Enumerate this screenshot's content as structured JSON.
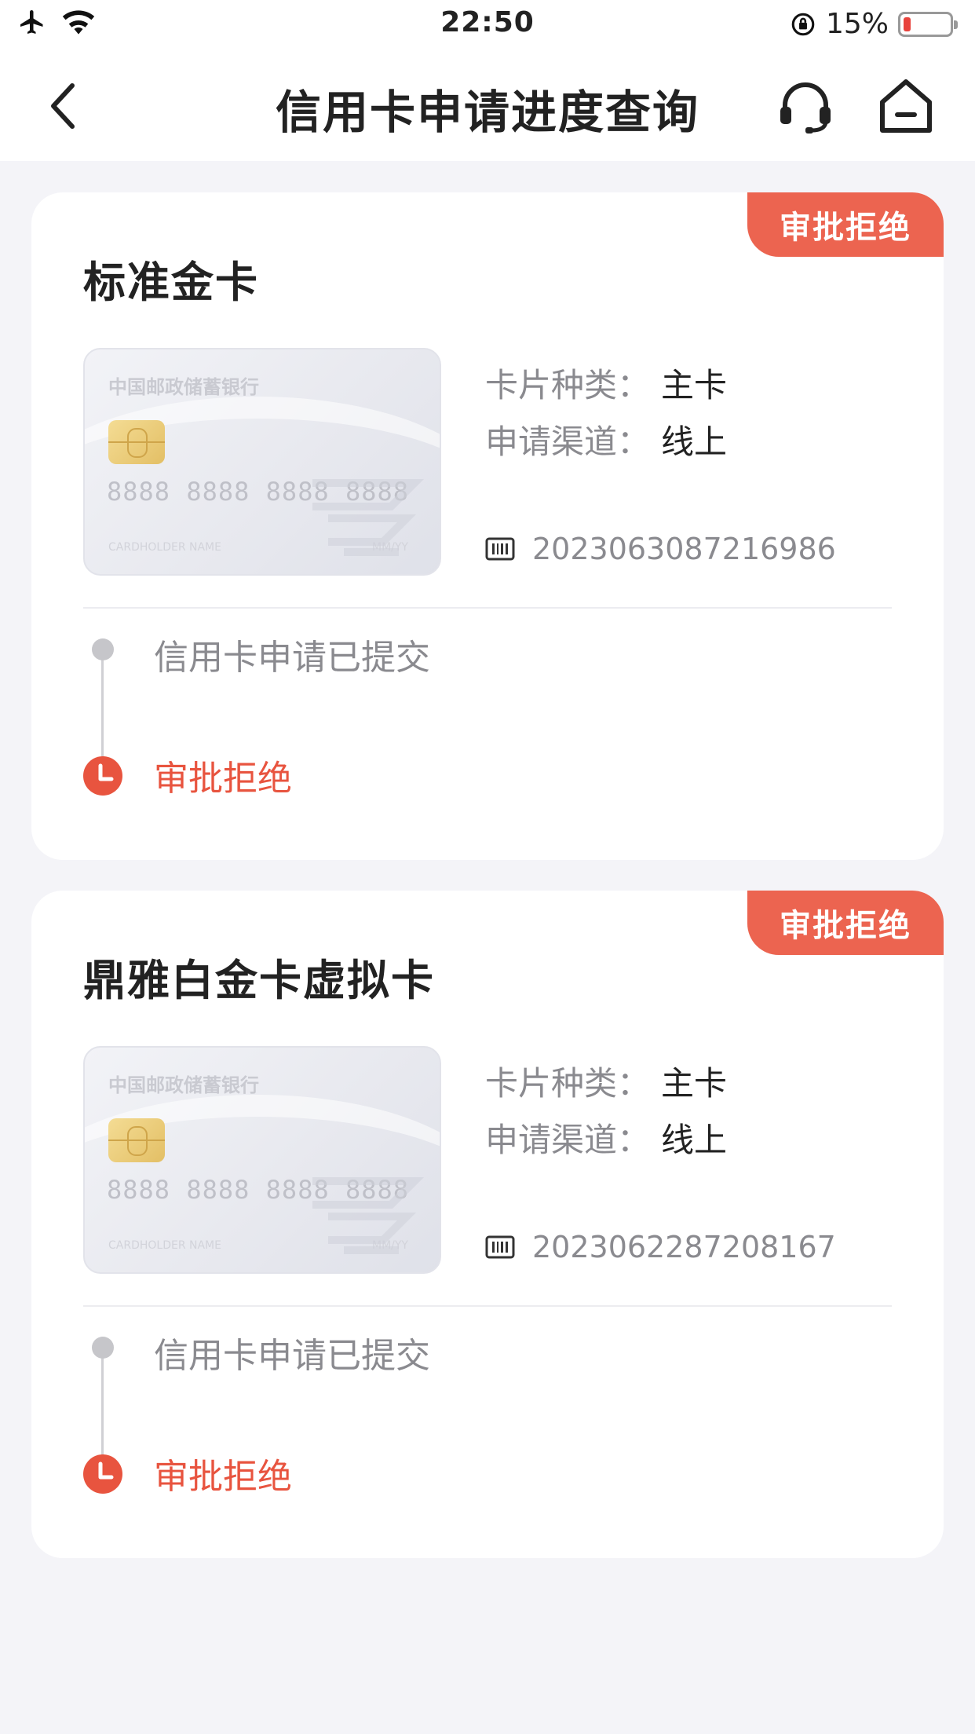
{
  "status_bar": {
    "time": "22:50",
    "battery_percent": "15%"
  },
  "header": {
    "title": "信用卡申请进度查询"
  },
  "applications": [
    {
      "status_badge": "审批拒绝",
      "card_name": "标准金卡",
      "card_visual": {
        "bank_name": "中国邮政储蓄银行",
        "number": "8888 8888 8888 8888",
        "holder_label": "CARDHOLDER NAME",
        "expiry_label": "MM/YY"
      },
      "card_type_label": "卡片种类：",
      "card_type_value": "主卡",
      "channel_label": "申请渠道：",
      "channel_value": "线上",
      "reference_number": "2023063087216986",
      "timeline": {
        "step1": "信用卡申请已提交",
        "step2": "审批拒绝"
      }
    },
    {
      "status_badge": "审批拒绝",
      "card_name": "鼎雅白金卡虚拟卡",
      "card_visual": {
        "bank_name": "中国邮政储蓄银行",
        "number": "8888 8888 8888 8888",
        "holder_label": "CARDHOLDER NAME",
        "expiry_label": "MM/YY"
      },
      "card_type_label": "卡片种类：",
      "card_type_value": "主卡",
      "channel_label": "申请渠道：",
      "channel_value": "线上",
      "reference_number": "2023062287208167",
      "timeline": {
        "step1": "信用卡申请已提交",
        "step2": "审批拒绝"
      }
    }
  ],
  "colors": {
    "accent": "#ec6450",
    "rejected_text": "#e8543f",
    "page_bg": "#f4f4f8"
  }
}
